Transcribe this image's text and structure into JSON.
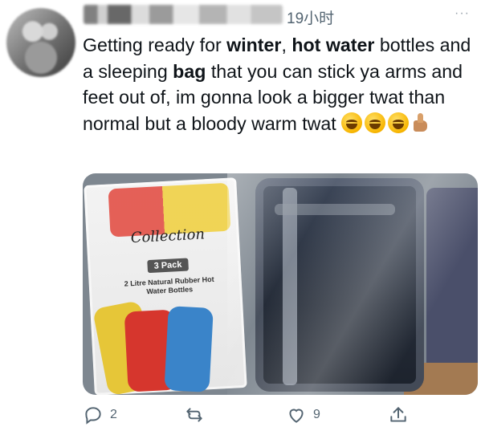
{
  "tweet": {
    "timestamp": "19小时",
    "more": "···",
    "text_parts": [
      {
        "t": "Getting ready for ",
        "b": false
      },
      {
        "t": "winter",
        "b": true
      },
      {
        "t": ", ",
        "b": false
      },
      {
        "t": "hot water",
        "b": true
      },
      {
        "t": " bottles and a sleeping ",
        "b": false
      },
      {
        "t": "bag",
        "b": true
      },
      {
        "t": " that you can stick ya arms and feet out of, im gonna look a bigger twat than normal but a bloody warm twat ",
        "b": false
      }
    ],
    "emojis": [
      "rofl-emoji",
      "rofl-emoji",
      "rofl-emoji",
      "thumbs-up-emoji"
    ]
  },
  "photo": {
    "brand": "Collection",
    "pack_label": "3 Pack",
    "pack_sub": "2 Litre Natural Rubber Hot Water Bottles"
  },
  "actions": {
    "reply_count": "2",
    "retweet_count": "",
    "like_count": "9"
  },
  "colors": {
    "muted": "#536471",
    "text": "#0f1419"
  }
}
